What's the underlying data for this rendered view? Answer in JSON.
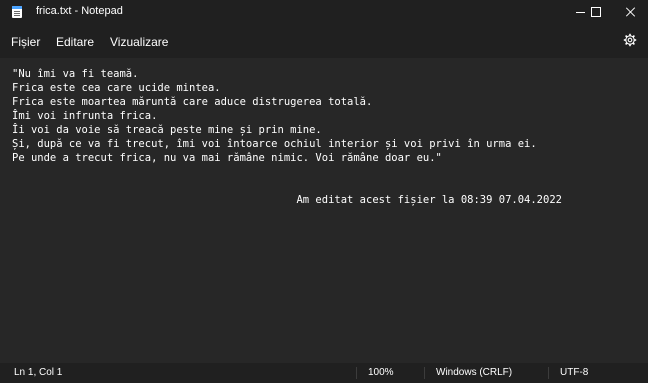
{
  "window": {
    "title": "frica.txt - Notepad",
    "icon": "notepad-icon",
    "controls": [
      "minimize-icon",
      "maximize-icon",
      "close-icon"
    ]
  },
  "menu": {
    "file": "Fișier",
    "edit": "Editare",
    "view": "Vizualizare",
    "settings_icon": "gear-icon"
  },
  "editor": {
    "lines": [
      "\"Nu îmi va fi teamă.",
      "Frica este cea care ucide mintea.",
      "Frica este moartea măruntă care aduce distrugerea totală.",
      "Îmi voi infrunta frica.",
      "Îi voi da voie să treacă peste mine și prin mine.",
      "Și, după ce va fi trecut, îmi voi întoarce ochiul interior și voi privi în urma ei.",
      "Pe unde a trecut frica, nu va mai rămâne nimic. Voi rămâne doar eu.\"",
      "",
      "",
      "                                             Am editat acest fișier la 08:39 07.04.2022"
    ]
  },
  "status": {
    "position": "Ln 1, Col 1",
    "zoom": "100%",
    "line_ending": "Windows (CRLF)",
    "encoding": "UTF-8"
  },
  "colors": {
    "background": "#202020",
    "editor_background": "#272727",
    "text": "#ffffff"
  }
}
